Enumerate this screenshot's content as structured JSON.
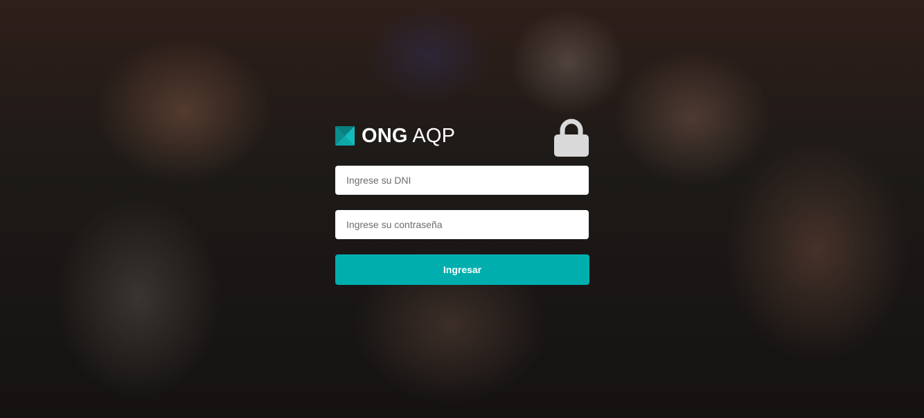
{
  "brand": {
    "name_bold": "ONG",
    "name_light": "AQP",
    "logo_icon": "ong-logo-icon",
    "lock_icon": "lock-icon"
  },
  "form": {
    "dni_placeholder": "Ingrese su DNI",
    "password_placeholder": "Ingrese su contraseña",
    "submit_label": "Ingresar"
  },
  "colors": {
    "accent": "#00aeae",
    "logo": "#0fa8a8",
    "lock": "#d9d9d9"
  }
}
